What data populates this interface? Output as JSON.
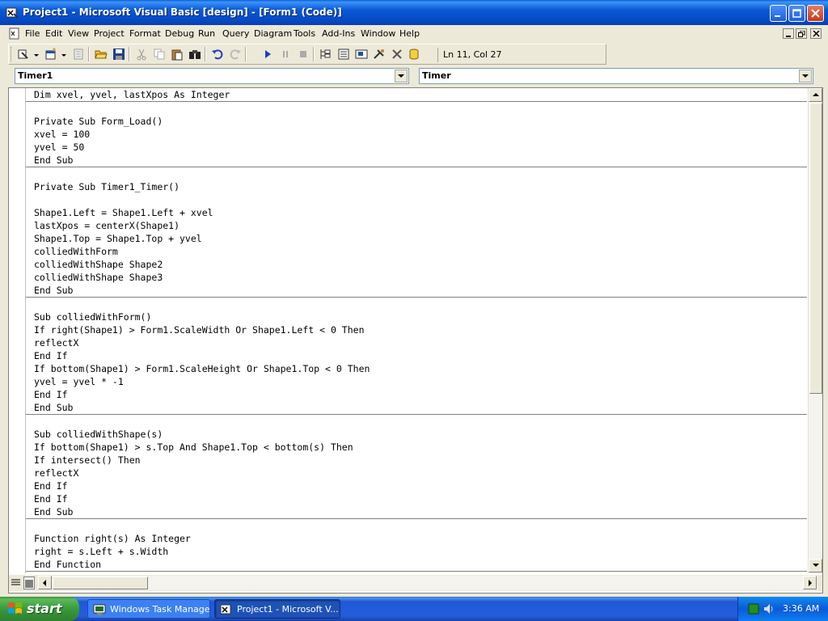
{
  "window": {
    "title": "Project1 - Microsoft Visual Basic [design] - [Form1 (Code)]"
  },
  "menubar": {
    "items": [
      "File",
      "Edit",
      "View",
      "Project",
      "Format",
      "Debug",
      "Run",
      "Query",
      "Diagram",
      "Tools",
      "Add-Ins",
      "Window",
      "Help"
    ]
  },
  "toolbar": {
    "cursor_position": "Ln 11, Col 27"
  },
  "object_combo": {
    "value": "Timer1"
  },
  "procedure_combo": {
    "value": "Timer"
  },
  "code": {
    "procedures": [
      [
        "Dim xvel, yvel, lastXpos As Integer"
      ],
      [
        "",
        "Private Sub Form_Load()",
        "xvel = 100",
        "yvel = 50",
        "End Sub"
      ],
      [
        "",
        "Private Sub Timer1_Timer()",
        "",
        "Shape1.Left = Shape1.Left + xvel",
        "lastXpos = centerX(Shape1)",
        "Shape1.Top = Shape1.Top + yvel",
        "colliedWithForm",
        "colliedWithShape Shape2",
        "colliedWithShape Shape3",
        "End Sub"
      ],
      [
        "",
        "Sub colliedWithForm()",
        "If right(Shape1) > Form1.ScaleWidth Or Shape1.Left < 0 Then",
        "reflectX",
        "End If",
        "If bottom(Shape1) > Form1.ScaleHeight Or Shape1.Top < 0 Then",
        "yvel = yvel * -1",
        "End If",
        "End Sub"
      ],
      [
        "",
        "Sub colliedWithShape(s)",
        "If bottom(Shape1) > s.Top And Shape1.Top < bottom(s) Then",
        "If intersect() Then",
        "reflectX",
        "End If",
        "End If",
        "End Sub"
      ],
      [
        "",
        "Function right(s) As Integer",
        "right = s.Left + s.Width",
        "End Function"
      ]
    ]
  },
  "taskbar": {
    "start_label": "start",
    "tasks": [
      {
        "label": "Windows Task Manager",
        "active": false
      },
      {
        "label": "Project1 - Microsoft V...",
        "active": true
      }
    ],
    "clock": "3:36 AM"
  },
  "colors": {
    "titlebar": "#0a58d6",
    "taskbar": "#245edb",
    "start": "#3a9a3a",
    "face": "#ece9d8"
  }
}
